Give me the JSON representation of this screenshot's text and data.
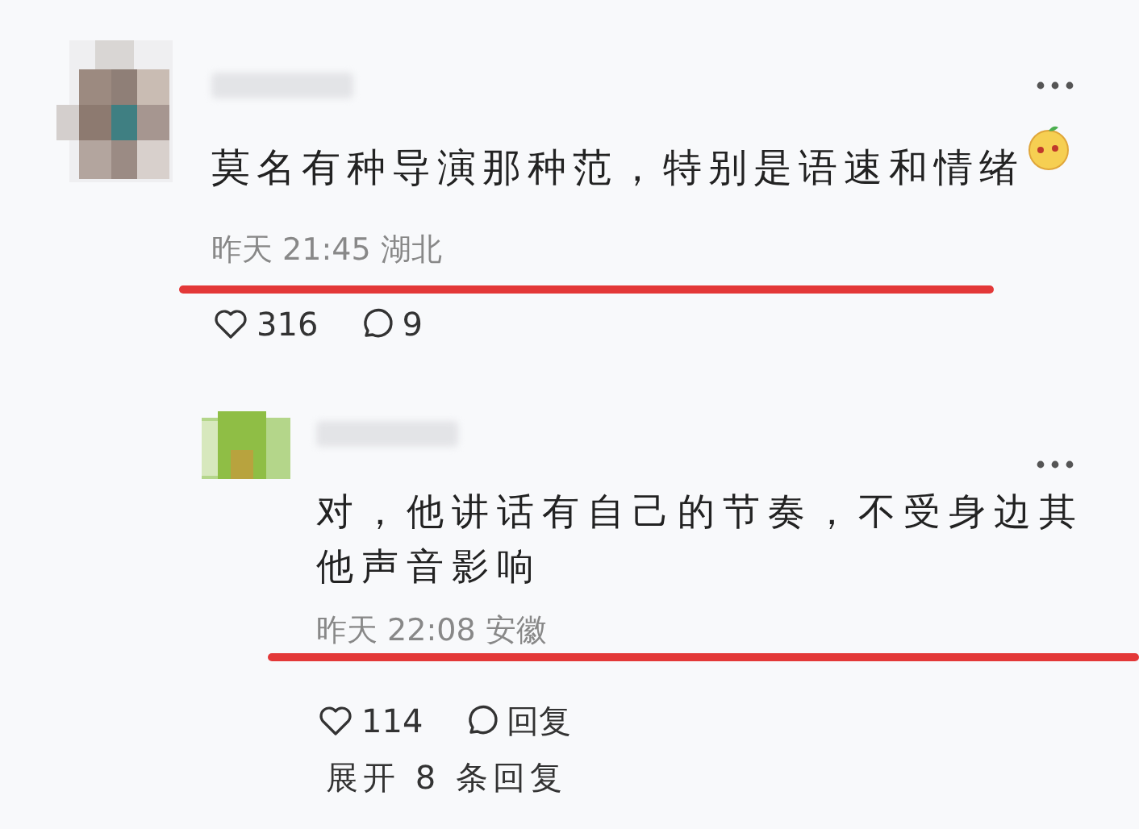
{
  "comments": [
    {
      "text": "莫名有种导演那种范，特别是语速和情绪",
      "time": "昨天 21:45 湖北",
      "likes": "316",
      "replies": "9",
      "underlined": true,
      "reply": false
    },
    {
      "text": "对，他讲话有自己的节奏，不受身边其他声音影响",
      "time": "昨天 22:08 安徽",
      "likes": "114",
      "replies": "回复",
      "underlined": true,
      "reply": true
    }
  ],
  "expand_replies": "展开 8 条回复"
}
